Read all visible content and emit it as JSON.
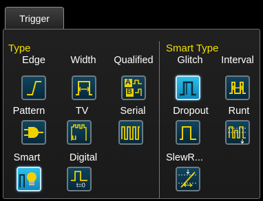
{
  "tab": {
    "label": "Trigger"
  },
  "sections": {
    "type": "Type",
    "smart_type": "Smart Type"
  },
  "triggers": {
    "edge": "Edge",
    "width": "Width",
    "qualified": "Qualified",
    "pattern": "Pattern",
    "tv": "TV",
    "serial": "Serial",
    "smart": "Smart",
    "digital": "Digital",
    "glitch": "Glitch",
    "interval": "Interval",
    "dropout": "Dropout",
    "runt": "Runt",
    "slewrate": "SlewR..."
  },
  "icon_text": {
    "qualified_a": "A",
    "qualified_b": "B",
    "tv_u": "u",
    "digital_t0": "t=0"
  },
  "selected": [
    "smart",
    "glitch"
  ],
  "colors": {
    "section_title": "#f0e000",
    "icon_waveform": "#f0d000",
    "button_bg": "#0d3a52",
    "button_selected_bg": "#1aa6d8"
  }
}
